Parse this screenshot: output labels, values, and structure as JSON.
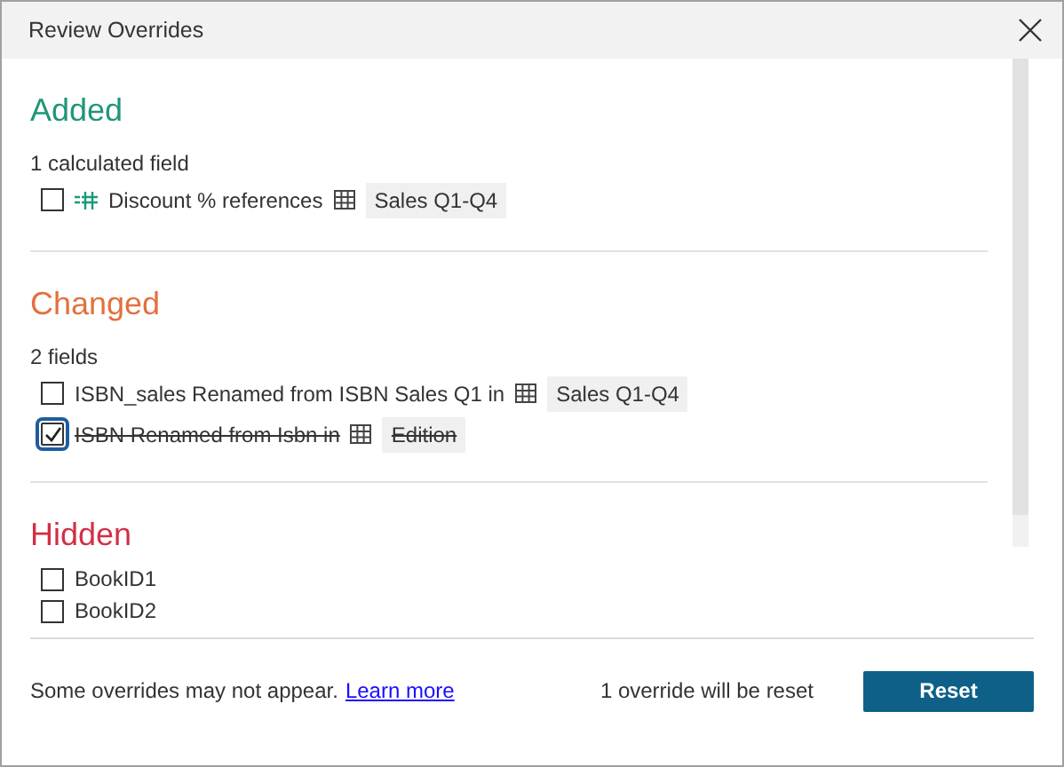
{
  "window": {
    "title": "Review Overrides"
  },
  "sections": [
    {
      "kind": "added",
      "title": "Added",
      "count": "1 calculated field",
      "items": [
        {
          "kind": "calculated",
          "checked": false,
          "text": "Discount % references",
          "table": "Sales Q1-Q4"
        }
      ]
    },
    {
      "kind": "changed",
      "title": "Changed",
      "count": "2 fields",
      "items": [
        {
          "kind": "field",
          "checked": false,
          "text": "ISBN_sales Renamed from ISBN Sales Q1 in",
          "table": "Sales Q1-Q4"
        },
        {
          "kind": "field",
          "checked": true,
          "text": "ISBN Renamed from Isbn in",
          "table": "Edition"
        }
      ]
    },
    {
      "kind": "hidden",
      "title": "Hidden",
      "items": [
        {
          "kind": "field",
          "checked": false,
          "text": "BookID1"
        },
        {
          "kind": "field",
          "checked": false,
          "text": "BookID2"
        }
      ]
    }
  ],
  "footer": {
    "note": "Some overrides may not appear.",
    "link": "Learn more",
    "status": "1 override will be reset",
    "button": "Reset"
  }
}
